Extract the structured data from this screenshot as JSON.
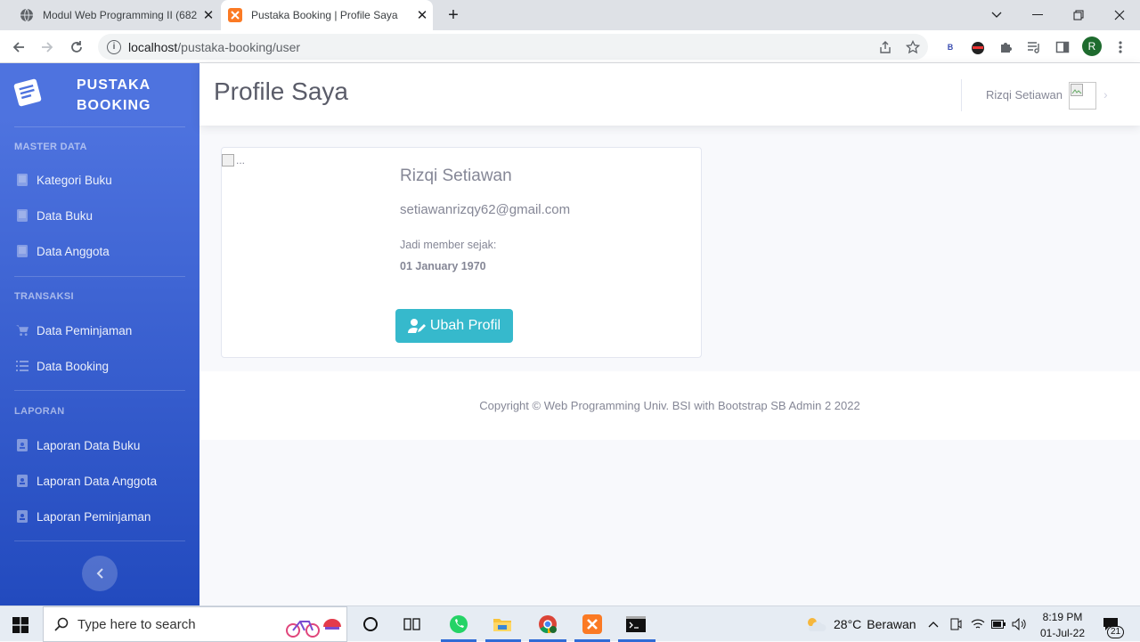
{
  "browser": {
    "tabs": [
      {
        "title": "Modul Web Programming II (682",
        "active": false
      },
      {
        "title": "Pustaka Booking | Profile Saya",
        "active": true
      }
    ],
    "url_host": "localhost",
    "url_path": "/pustaka-booking/user",
    "profile_initial": "R",
    "ext_b_label": "B"
  },
  "sidebar": {
    "brand_line1": "PUSTAKA",
    "brand_line2": "BOOKING",
    "sections": [
      {
        "heading": "MASTER DATA",
        "items": [
          "Kategori Buku",
          "Data Buku",
          "Data Anggota"
        ]
      },
      {
        "heading": "TRANSAKSI",
        "items": [
          "Data Peminjaman",
          "Data Booking"
        ]
      },
      {
        "heading": "LAPORAN",
        "items": [
          "Laporan Data Buku",
          "Laporan Data Anggota",
          "Laporan Peminjaman"
        ]
      }
    ]
  },
  "topbar": {
    "page_title": "Profile Saya",
    "user_name": "Rizqi Setiawan"
  },
  "profile": {
    "img_alt": "...",
    "name": "Rizqi Setiawan",
    "email": "setiawanrizqy62@gmail.com",
    "member_since_label": "Jadi member sejak:",
    "member_since": "01 January 1970",
    "edit_button": "Ubah Profil"
  },
  "footer": {
    "copyright": "Copyright © Web Programming Univ. BSI with Bootstrap SB Admin 2 2022"
  },
  "taskbar": {
    "search_placeholder": "Type here to search",
    "weather_temp": "28°C",
    "weather_text": "Berawan",
    "time": "8:19 PM",
    "date": "01-Jul-22",
    "notif_count": "21"
  },
  "colors": {
    "primary": "#4e73df",
    "info": "#36b9cc",
    "text_muted": "#858796"
  }
}
